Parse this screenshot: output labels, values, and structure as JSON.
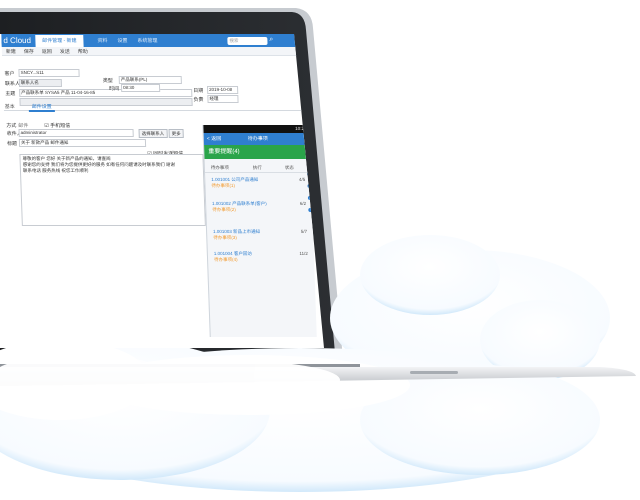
{
  "app": {
    "brand": "d Cloud",
    "active_tab": "邮件管理 - 新建",
    "tabs": [
      "资料",
      "设置",
      "系统管理"
    ],
    "search_placeholder": "搜索"
  },
  "toolbar": {
    "items": [
      "新建",
      "保存",
      "返回",
      "发送",
      "帮助"
    ]
  },
  "form": {
    "label_customer": "客户",
    "value_customer": "SNCY...S11",
    "label_type": "类型",
    "value_type": "产品联系(PL)",
    "label_contact": "联系人",
    "value_contact": "联系人名",
    "label_date": "日期",
    "value_date": "2019-10-08",
    "label_subject": "主题",
    "value_subject": "产品联系单 SYSA5 产品 11-04-16-85",
    "label_time": "时间",
    "value_time": "08:30",
    "label_owner": "负责",
    "value_owner": "经理"
  },
  "tabs": {
    "plain": "基本",
    "active": "邮件设置"
  },
  "mail": {
    "label_mode": "方式",
    "option_email": "邮件",
    "option_sms": "手机短信",
    "label_to": "收件人",
    "value_to": "administrator",
    "button_pick": "选择联系人",
    "button_more": "更多",
    "label_title": "标题",
    "value_title": "关于 新款产品 邮件通知",
    "check_label": "同时发送短信",
    "body_line1": "尊敬的客户 您好 关于新产品的通知，请查阅",
    "body_line2": "感谢您的支持 我们将为您提供更好的服务 如有任何问题请及时联系我们 谢谢",
    "body_line3": "联系电话 服务热线 祝您工作顺利"
  },
  "phone": {
    "status": "10:25",
    "back": "< 返回",
    "title": "待办事项",
    "header": "重要提醒(4)",
    "col_a": "待办事项",
    "col_b": "执行",
    "col_c": "状态",
    "items": [
      {
        "id": "1.001001",
        "name": "公司产品通知",
        "count": "4/5",
        "status": "待办事项(1)"
      },
      {
        "id": "1.001002",
        "name": "产品联系单(客户)",
        "count": "6/2",
        "status": "待办事项(2)"
      },
      {
        "id": "1.001003",
        "name": "新品上市通知",
        "count": "5/7",
        "status": "待办事项(3)"
      },
      {
        "id": "1.001004",
        "name": "客户回访",
        "count": "11/2",
        "status": "待办事项(4)"
      }
    ]
  },
  "colors": {
    "brand_blue": "#2f7fd0",
    "header_green": "#2aa44a",
    "accent_orange": "#f29a2e"
  }
}
